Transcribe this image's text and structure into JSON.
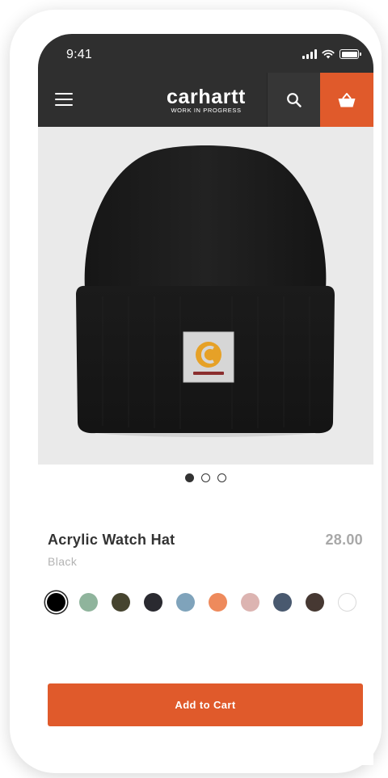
{
  "status_bar": {
    "time": "9:41",
    "icons": [
      "signal-icon",
      "wifi-icon",
      "battery-icon"
    ]
  },
  "header": {
    "menu_icon": "hamburger-menu-icon",
    "logo_word": "carhartt",
    "logo_tagline": "WORK IN PROGRESS",
    "search_icon": "search-icon",
    "cart_icon": "basket-icon",
    "background_color": "#2f2f2f",
    "cart_button_color": "#e05a2b"
  },
  "product": {
    "title": "Acrylic Watch Hat",
    "price": "28.00",
    "color_name": "Black",
    "image_count": 3,
    "active_image_index": 0,
    "swatches": [
      {
        "name": "Black",
        "hex": "#000000",
        "selected": true
      },
      {
        "name": "sage",
        "hex": "#8fb49c",
        "selected": false
      },
      {
        "name": "olive",
        "hex": "#46442f",
        "selected": false
      },
      {
        "name": "dark navy",
        "hex": "#2a2a30",
        "selected": false
      },
      {
        "name": "light blue",
        "hex": "#7fa3bb",
        "selected": false
      },
      {
        "name": "orange",
        "hex": "#ee8a5c",
        "selected": false
      },
      {
        "name": "pink",
        "hex": "#dcb4b1",
        "selected": false
      },
      {
        "name": "slate blue",
        "hex": "#49596f",
        "selected": false
      },
      {
        "name": "brown",
        "hex": "#463832",
        "selected": false
      },
      {
        "name": "white",
        "hex": "#ffffff",
        "selected": false
      }
    ]
  },
  "actions": {
    "add_to_cart_label": "Add to Cart",
    "accent_color": "#e05a2b"
  }
}
